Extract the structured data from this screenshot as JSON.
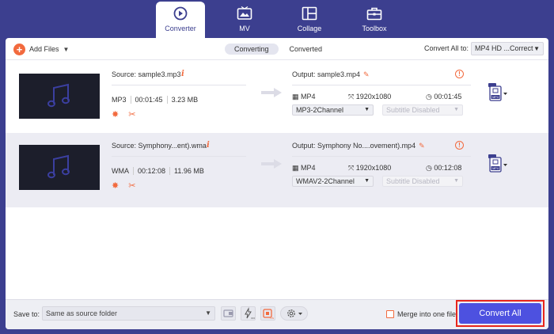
{
  "nav": {
    "tabs": [
      {
        "label": "Converter",
        "icon": "converter-icon",
        "active": true
      },
      {
        "label": "MV",
        "icon": "mv-icon",
        "active": false
      },
      {
        "label": "Collage",
        "icon": "collage-icon",
        "active": false
      },
      {
        "label": "Toolbox",
        "icon": "toolbox-icon",
        "active": false
      }
    ]
  },
  "toolbar": {
    "add_files": "Add Files",
    "tab_converting": "Converting",
    "tab_converted": "Converted",
    "convert_all_to_label": "Convert All to:",
    "convert_all_to_value": "MP4 HD ...Correct"
  },
  "files": [
    {
      "source": "Source: sample3.mp3",
      "format": "MP3",
      "duration": "00:01:45",
      "size": "3.23 MB",
      "output": "Output: sample3.mp4",
      "out_format": "MP4",
      "out_resolution": "1920x1080",
      "out_duration": "00:01:45",
      "audio_track": "MP3-2Channel",
      "subtitle": "Subtitle Disabled",
      "format_badge": "MP4"
    },
    {
      "source": "Source: Symphony...ent).wma",
      "format": "WMA",
      "duration": "00:12:08",
      "size": "11.96 MB",
      "output": "Output: Symphony No....ovement).mp4",
      "out_format": "MP4",
      "out_resolution": "1920x1080",
      "out_duration": "00:12:08",
      "audio_track": "WMAV2-2Channel",
      "subtitle": "Subtitle Disabled",
      "format_badge": "MP4"
    }
  ],
  "bottom": {
    "save_to_label": "Save to:",
    "save_to_value": "Same as source folder",
    "merge_label": "Merge into one file",
    "convert_all": "Convert All"
  },
  "colors": {
    "brand": "#3c3f8f",
    "accent": "#f26a3e",
    "button": "#4d51e0",
    "highlight": "#e8261c"
  }
}
